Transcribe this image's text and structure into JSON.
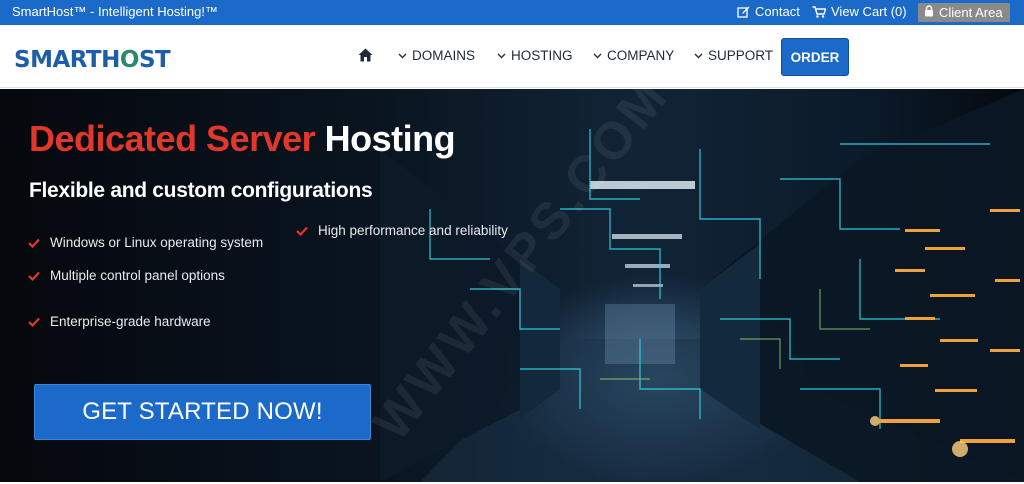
{
  "topbar": {
    "tagline": "SmartHost™ - Intelligent Hosting!™",
    "contact_label": "Contact",
    "cart_label": "View Cart (0)",
    "client_area_label": "Client Area",
    "icons": {
      "contact": "edit-icon",
      "cart": "cart-icon",
      "client_area": "lock-icon"
    }
  },
  "header": {
    "logo_left": "SMARTH",
    "logo_o": "O",
    "logo_right": "ST",
    "nav": [
      {
        "label": "DOMAINS"
      },
      {
        "label": "HOSTING"
      },
      {
        "label": "COMPANY"
      },
      {
        "label": "SUPPORT"
      }
    ],
    "home_icon": "home-icon",
    "order_label": "ORDER"
  },
  "hero": {
    "title_highlight": "Dedicated Server",
    "title_rest": " Hosting",
    "subtitle": "Flexible and custom configurations",
    "features": [
      "Windows or Linux operating system",
      "Multiple control panel options",
      "Enterprise-grade hardware",
      "High performance and reliability"
    ],
    "cta_label": "GET STARTED NOW!",
    "watermark": "WWW.VPS.COM"
  },
  "colors": {
    "brand_blue": "#1b6ac9",
    "accent_red": "#e1382b",
    "client_area_grey": "#8a8a8a",
    "logo_blue": "#1d5ea8",
    "logo_green": "#2a8a6a"
  }
}
